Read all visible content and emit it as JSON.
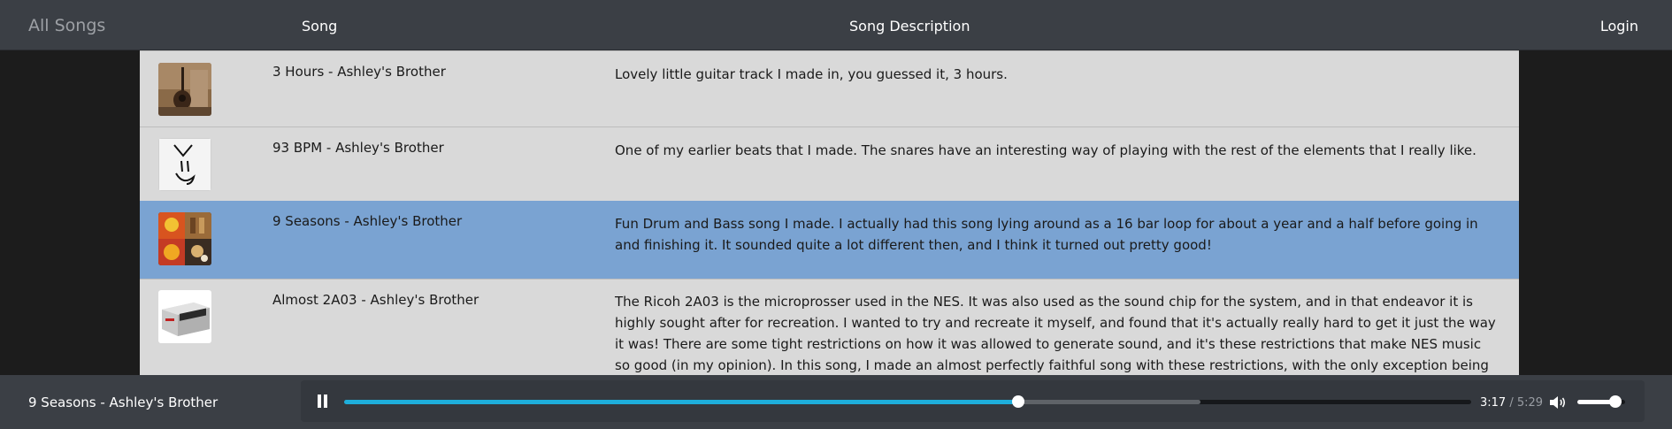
{
  "nav": {
    "brand": "All Songs",
    "song_header": "Song",
    "description_header": "Song Description",
    "login": "Login"
  },
  "songs": [
    {
      "title": "3 Hours - Ashley's Brother",
      "description": "Lovely little guitar track I made in, you guessed it, 3 hours.",
      "thumbnail": "guitar-photo"
    },
    {
      "title": "93 BPM - Ashley's Brother",
      "description": "One of my earlier beats that I made. The snares have an interesting way of playing with the rest of the elements that I really like.",
      "thumbnail": "doodle-face"
    },
    {
      "title": "9 Seasons - Ashley's Brother",
      "description": "Fun Drum and Bass song I made. I actually had this song lying around as a 16 bar loop for about a year and a half before going in and finishing it. It sounded quite a lot different then, and I think it turned out pretty good!",
      "thumbnail": "seasons-collage",
      "active": true
    },
    {
      "title": "Almost 2A03 - Ashley's Brother",
      "description": "The Ricoh 2A03 is the microprosser used in the NES. It was also used as the sound chip for the system, and in that endeavor it is highly sought after for recreation. I wanted to try and recreate it myself, and found that it's actually really hard to get it just the way it was! There are some tight restrictions on how it was allowed to generate sound, and it's these restrictions that make NES music so good (in my opinion). In this song, I made an almost perfectly faithful song with these restrictions, with the only exception being the drums. I always liked the way this",
      "thumbnail": "nes-console"
    }
  ],
  "player": {
    "now_playing": "9 Seasons - Ashley's Brother",
    "pause_icon": "pause-icon",
    "current_time": "3:17",
    "separator": " / ",
    "duration": "5:29",
    "played_fraction": 0.598,
    "buffered_fraction": 0.76,
    "volume_fraction": 0.8,
    "volume_icon": "volume-icon"
  },
  "colors": {
    "topbar": "#3b3f45",
    "list_bg": "#d9d9d9",
    "active_row": "#7aa3d2",
    "progress_played": "#1eaedb",
    "page_bg": "#1c1c1c"
  }
}
